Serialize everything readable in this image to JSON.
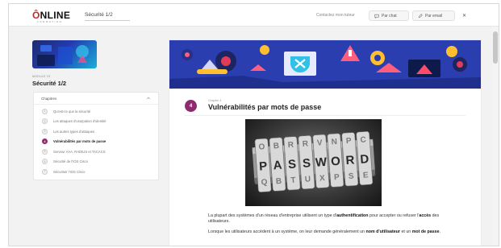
{
  "header": {
    "logo_main": "NLINE",
    "logo_accent": "Ô",
    "logo_sub": "FORMATION",
    "course_title": "Sécurité 1/2",
    "contact_label": "Contactez mon tuteur",
    "chat_label": "Par chat",
    "email_label": "Par email"
  },
  "sidebar": {
    "module_label": "MODULE 23",
    "module_name": "Sécurité 1/2",
    "chapters_heading": "Chapitres",
    "chapters": [
      {
        "num": "1",
        "label": "Qu'est-ce que la sécurité",
        "active": false
      },
      {
        "num": "2",
        "label": "Les attaques d'usurpation d'identité",
        "active": false
      },
      {
        "num": "3",
        "label": "Les autres types d'attaques",
        "active": false
      },
      {
        "num": "4",
        "label": "Vulnérabilités par mots de passe",
        "active": true
      },
      {
        "num": "5",
        "label": "Serveur AAA, RADIUS et TACACS",
        "active": false
      },
      {
        "num": "6",
        "label": "Sécurité de l'IOS Cisco",
        "active": false
      },
      {
        "num": "7",
        "label": "Sécuriser l'IOS Cisco",
        "active": false
      }
    ]
  },
  "content": {
    "chapter_number": "4",
    "chapter_label": "Chapitre 4",
    "chapter_title": "Vulnérabilités par mots de passe",
    "image_word": "PASSWORD",
    "p1_a": "La plupart des systèmes d'un réseau d'entreprise utilisent un type d'",
    "p1_b": "authentification",
    "p1_c": " pour accepter ou refuser l'",
    "p1_d": "accès",
    "p1_e": " des utilisateurs.",
    "p2_a": "Lorsque les utilisateurs accèdent à un système, on leur demande généralement un ",
    "p2_b": "nom d'utilisateur",
    "p2_c": " et un ",
    "p2_d": "mot de passe",
    "p2_e": "."
  },
  "colors": {
    "accent": "#8e2a6e",
    "logo_red": "#c62828",
    "banner_blue": "#2a3eb0"
  },
  "icons": {
    "chat": "chat-icon",
    "email": "pencil-icon",
    "close": "close-icon",
    "chevron": "chevron-up-icon"
  }
}
